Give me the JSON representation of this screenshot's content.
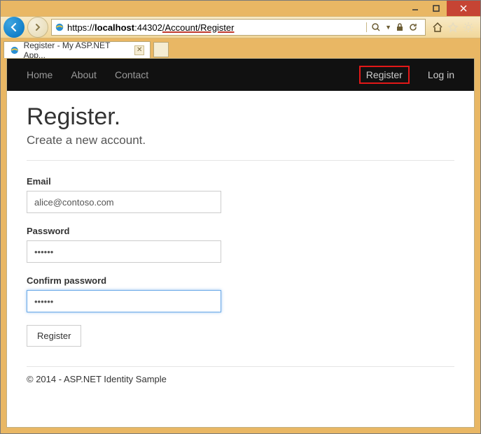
{
  "browser": {
    "url_prefix": "https://",
    "url_host": "localhost",
    "url_port": ":44302",
    "url_path": "/Account/Register",
    "tab_title": "Register - My ASP.NET App...",
    "search_icon": "search",
    "refresh_icon": "refresh"
  },
  "nav": {
    "home": "Home",
    "about": "About",
    "contact": "Contact",
    "register": "Register",
    "login": "Log in"
  },
  "page": {
    "heading": "Register.",
    "subheading": "Create a new account.",
    "email_label": "Email",
    "email_value": "alice@contoso.com",
    "password_label": "Password",
    "password_value": "••••••",
    "confirm_label": "Confirm password",
    "confirm_value": "••••••",
    "register_button": "Register"
  },
  "footer": {
    "text": "© 2014 - ASP.NET Identity Sample"
  }
}
